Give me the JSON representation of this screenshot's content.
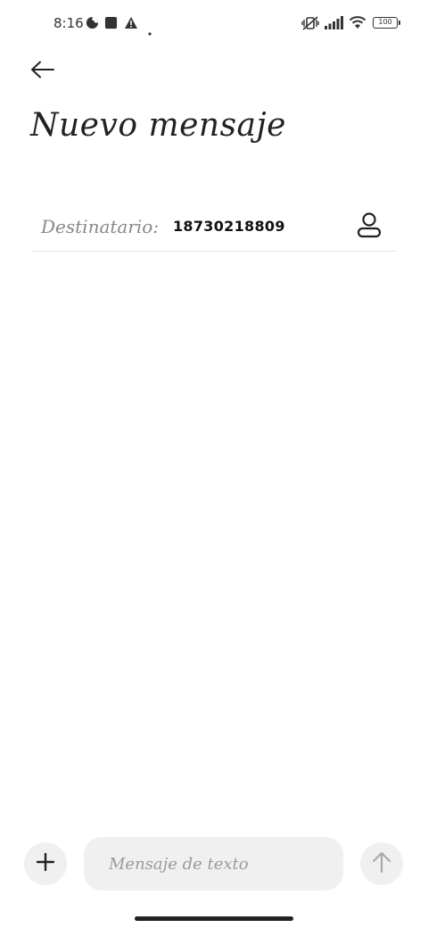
{
  "status_bar": {
    "time": "8:16",
    "battery": "100",
    "icons": [
      "data-saver-icon",
      "square-notification-icon",
      "warning-icon",
      "dot-icon",
      "vibrate-off-icon",
      "signal-icon",
      "wifi-icon",
      "battery-icon"
    ]
  },
  "header": {
    "back_icon": "arrow-left-icon",
    "title": "Nuevo mensaje"
  },
  "recipient": {
    "label": "Destinatario:",
    "value": "18730218809",
    "contact_icon": "person-icon"
  },
  "compose": {
    "attach_icon": "plus-icon",
    "placeholder": "Mensaje de texto",
    "send_icon": "arrow-up-icon"
  },
  "colors": {
    "background": "#ffffff",
    "surface": "#f0f0f0",
    "text": "#222222",
    "muted": "#888888",
    "divider": "#e2e2e2"
  }
}
